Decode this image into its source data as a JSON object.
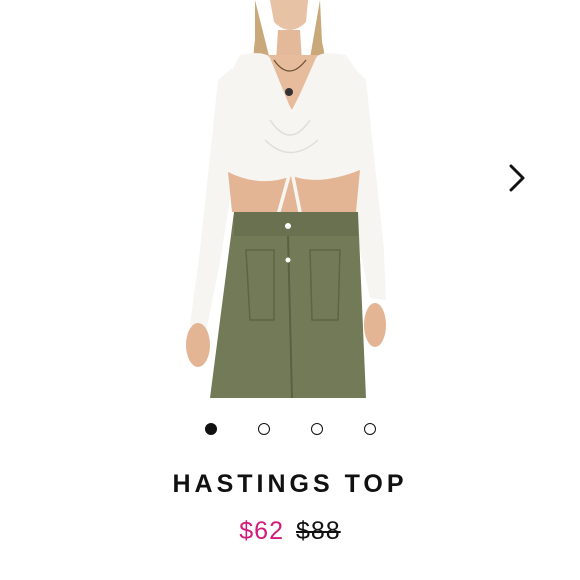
{
  "product": {
    "title": "HASTINGS TOP",
    "sale_price": "$62",
    "original_price": "$88"
  },
  "gallery": {
    "image_count": 4,
    "active_index": 0
  },
  "icons": {
    "next": "chevron-right-icon"
  },
  "colors": {
    "sale_price": "#d11a7a",
    "text": "#111111",
    "background": "#ffffff"
  }
}
